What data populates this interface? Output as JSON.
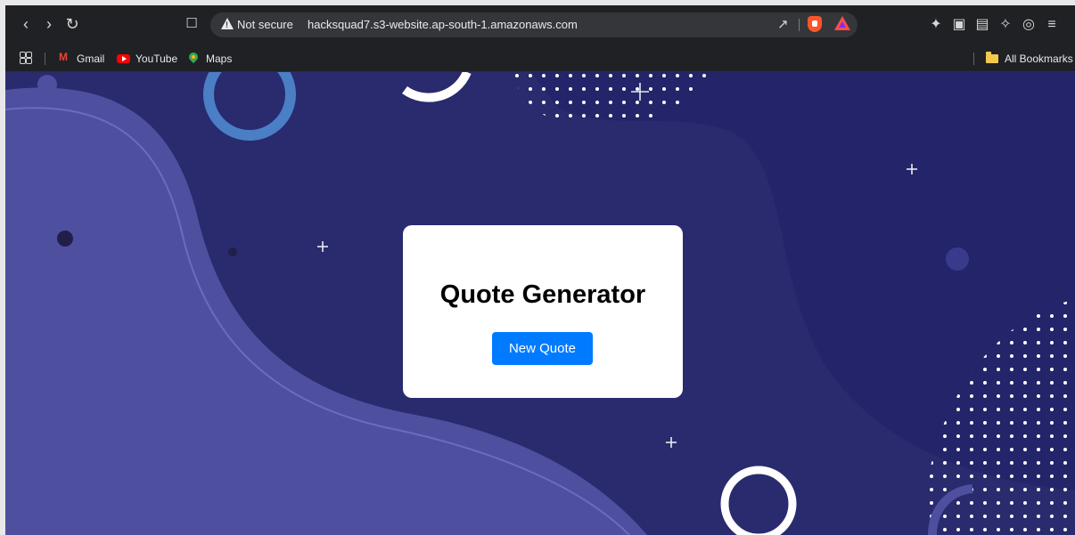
{
  "browser": {
    "security_label": "Not secure",
    "url": "hacksquad7.s3-website.ap-south-1.amazonaws.com",
    "nav_icons": [
      "back-icon",
      "forward-icon",
      "reload-icon",
      "bookmark-icon"
    ],
    "right_icons": [
      "extensions-icon",
      "sidebar-icon",
      "wallet-icon",
      "leo-ai-icon",
      "vpn-icon",
      "menu-icon"
    ]
  },
  "bookmarks": {
    "items": [
      {
        "label": "Gmail",
        "icon": "gmail-icon"
      },
      {
        "label": "YouTube",
        "icon": "youtube-icon"
      },
      {
        "label": "Maps",
        "icon": "maps-icon"
      }
    ],
    "all_bookmarks_label": "All Bookmarks"
  },
  "page": {
    "title": "Quote Generator",
    "button_label": "New Quote",
    "colors": {
      "background": "#2a2a6e",
      "wave": "#4f4fa0",
      "button": "#007bff",
      "card": "#ffffff"
    }
  }
}
